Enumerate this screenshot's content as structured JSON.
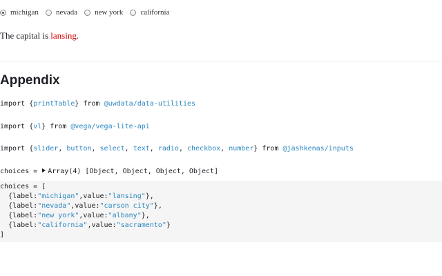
{
  "radio_group": {
    "selected": "michigan",
    "options": [
      {
        "label": "michigan"
      },
      {
        "label": "nevada"
      },
      {
        "label": "new york"
      },
      {
        "label": "california"
      }
    ]
  },
  "capital": {
    "prefix": "The capital is ",
    "answer": "lansing",
    "suffix": ".",
    "answer_color": "#d00000"
  },
  "appendix": {
    "title": "Appendix",
    "imports": [
      {
        "kw": "import ",
        "open": "{",
        "names": [
          "printTable"
        ],
        "close": "}",
        "from": " from ",
        "source": "@uwdata/data-utilities"
      },
      {
        "kw": "import ",
        "open": "{",
        "names": [
          "vl"
        ],
        "close": "}",
        "from": " from ",
        "source": "@vega/vega-lite-api"
      },
      {
        "kw": "import ",
        "open": "{",
        "names": [
          "slider",
          "button",
          "select",
          "text",
          "radio",
          "checkbox",
          "number"
        ],
        "close": "}",
        "from": " from ",
        "source": "@jashkenas/inputs"
      }
    ],
    "choices_summary": {
      "prefix": "choices = ",
      "value": "Array(4) [Object, Object, Object, Object]"
    },
    "choices_code": {
      "open": "choices = [",
      "items": [
        {
          "label": "\"michigan\"",
          "value": "\"lansing\""
        },
        {
          "label": "\"nevada\"",
          "value": "\"carson city\""
        },
        {
          "label": "\"new york\"",
          "value": "\"albany\""
        },
        {
          "label": "\"california\"",
          "value": "\"sacramento\""
        }
      ],
      "close": "]"
    }
  },
  "colors": {
    "link_blue": "#2a86c0",
    "code_bg": "#f5f5f5"
  }
}
